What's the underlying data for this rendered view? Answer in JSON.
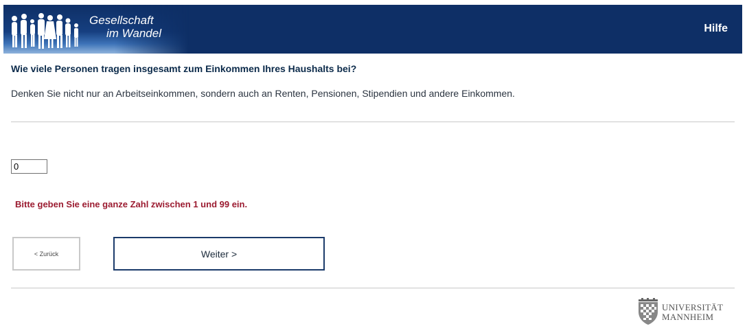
{
  "header": {
    "logo_line1": "Gesellschaft",
    "logo_line2": "im Wandel",
    "help_label": "Hilfe",
    "background_color": "#0e2f66"
  },
  "question": {
    "title": "Wie viele Personen tragen insgesamt zum Einkommen Ihres Haushalts bei?",
    "instruction": "Denken Sie nicht nur an Arbeitseinkommen, sondern auch an Renten, Pensionen, Stipendien und andere Einkommen."
  },
  "answer": {
    "value": "0"
  },
  "error": {
    "message": "Bitte geben Sie eine ganze Zahl zwischen 1 und 99 ein.",
    "color": "#9b1b30"
  },
  "navigation": {
    "back_label": "< Zurück",
    "next_label": "Weiter >"
  },
  "footer": {
    "university_line1": "UNIVERSITÄT",
    "university_line2": "MANNHEIM"
  }
}
